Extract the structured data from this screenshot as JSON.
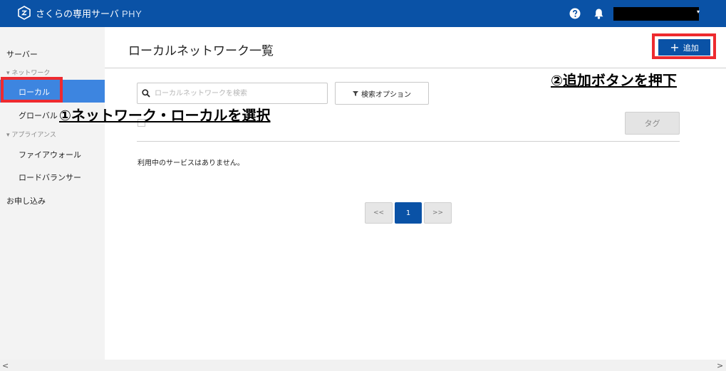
{
  "header": {
    "brand_main": "さくらの専用サーバ",
    "brand_product": "PHY",
    "help_icon": "question-circle-icon",
    "bell_icon": "bell-icon",
    "user_caret": "▾",
    "colors": {
      "header_bg": "#0a52a6",
      "accent": "#3d85e0",
      "highlight": "#ee2a2f"
    }
  },
  "sidebar": {
    "server": "サーバー",
    "network_section": "▾ ネットワーク",
    "local": "ローカル",
    "global": "グローバル",
    "appliance_section": "▾ アプライアンス",
    "firewall": "ファイアウォール",
    "load_balancer": "ロードバランサー",
    "apply": "お申し込み"
  },
  "main": {
    "title": "ローカルネットワーク一覧",
    "add_label": "追加",
    "search_placeholder": "ローカルネットワークを検索",
    "search_value": "",
    "search_option_label": "検索オプション",
    "tag_label": "タグ",
    "empty_message": "利用中のサービスはありません。",
    "pagination": {
      "prev": "<<",
      "current": "1",
      "next": ">>"
    }
  },
  "annotations": {
    "step1": "①ネットワーク・ローカルを選択",
    "step2": "②追加ボタンを押下"
  },
  "scrollbar": {
    "left_arrow": "<",
    "right_arrow": ">"
  }
}
